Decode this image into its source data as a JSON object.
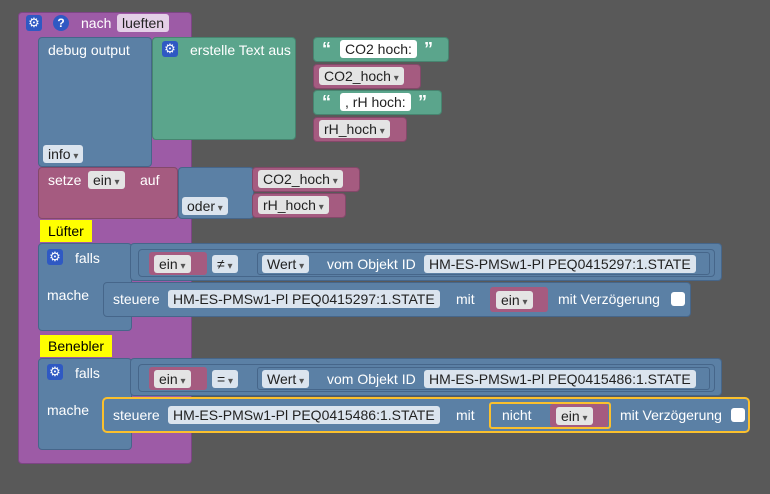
{
  "function_block": {
    "keyword": "nach",
    "name": "lueften"
  },
  "debug_block": {
    "label": "debug output",
    "level": "info"
  },
  "text_join": {
    "label": "erstelle Text aus",
    "text1": "CO2 hoch:",
    "var1": "CO2_hoch",
    "text2": ", rH hoch:",
    "var2": "rH_hoch"
  },
  "set_block": {
    "label_setze": "setze",
    "var": "ein",
    "label_auf": "auf",
    "or_label": "oder",
    "operand1": "CO2_hoch",
    "operand2": "rH_hoch"
  },
  "comments": {
    "luefter": "Lüfter",
    "benebler": "Benebler"
  },
  "if_block_1": {
    "falls": "falls",
    "mache": "mache",
    "left_var": "ein",
    "operator": "≠",
    "wert": "Wert",
    "vom_objekt": "vom Objekt ID",
    "object_id": "HM-ES-PMSw1-Pl PEQ0415297:1.STATE",
    "steuere": "steuere",
    "target_id": "HM-ES-PMSw1-Pl PEQ0415297:1.STATE",
    "mit": "mit",
    "value_var": "ein",
    "delay_label": "mit Verzögerung"
  },
  "if_block_2": {
    "falls": "falls",
    "mache": "mache",
    "left_var": "ein",
    "operator": "=",
    "wert": "Wert",
    "vom_objekt": "vom Objekt ID",
    "object_id": "HM-ES-PMSw1-Pl PEQ0415486:1.STATE",
    "steuere": "steuere",
    "target_id": "HM-ES-PMSw1-Pl PEQ0415486:1.STATE",
    "mit": "mit",
    "not_label": "nicht",
    "value_var": "ein",
    "delay_label": "mit Verzögerung"
  },
  "icons": {
    "gear": "gear-icon",
    "help": "help-icon"
  },
  "colors": {
    "background": "#595959",
    "function": "#9d5ba6",
    "debug": "#5b80a5",
    "text": "#5ba58c",
    "variable": "#a55b80",
    "logic": "#5b80a5",
    "comment": "#ffff00",
    "selected": "#fbc02d"
  }
}
